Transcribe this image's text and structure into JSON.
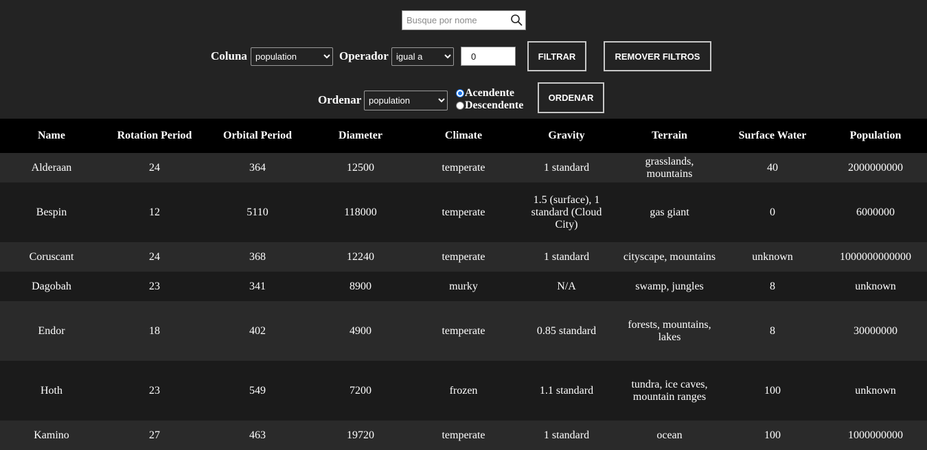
{
  "search": {
    "placeholder": "Busque por nome",
    "value": ""
  },
  "filter": {
    "column_label": "Coluna",
    "column_value": "population",
    "operator_label": "Operador",
    "operator_value": "igual a",
    "number_value": "0",
    "filter_button": "FILTRAR",
    "remove_button": "REMOVER FILTROS"
  },
  "sort": {
    "label": "Ordenar",
    "column_value": "population",
    "asc_label": "Acendente",
    "desc_label": "Descendente",
    "selected": "asc",
    "button": "ORDENAR"
  },
  "table": {
    "headers": [
      "Name",
      "Rotation Period",
      "Orbital Period",
      "Diameter",
      "Climate",
      "Gravity",
      "Terrain",
      "Surface Water",
      "Population"
    ],
    "rows": [
      [
        "Alderaan",
        "24",
        "364",
        "12500",
        "temperate",
        "1 standard",
        "grasslands, mountains",
        "40",
        "2000000000"
      ],
      [
        "Bespin",
        "12",
        "5110",
        "118000",
        "temperate",
        "1.5 (surface), 1 standard (Cloud City)",
        "gas giant",
        "0",
        "6000000"
      ],
      [
        "Coruscant",
        "24",
        "368",
        "12240",
        "temperate",
        "1 standard",
        "cityscape, mountains",
        "unknown",
        "1000000000000"
      ],
      [
        "Dagobah",
        "23",
        "341",
        "8900",
        "murky",
        "N/A",
        "swamp, jungles",
        "8",
        "unknown"
      ],
      [
        "Endor",
        "18",
        "402",
        "4900",
        "temperate",
        "0.85 standard",
        "forests, mountains, lakes",
        "8",
        "30000000"
      ],
      [
        "Hoth",
        "23",
        "549",
        "7200",
        "frozen",
        "1.1 standard",
        "tundra, ice caves, mountain ranges",
        "100",
        "unknown"
      ],
      [
        "Kamino",
        "27",
        "463",
        "19720",
        "temperate",
        "1 standard",
        "ocean",
        "100",
        "1000000000"
      ]
    ]
  }
}
